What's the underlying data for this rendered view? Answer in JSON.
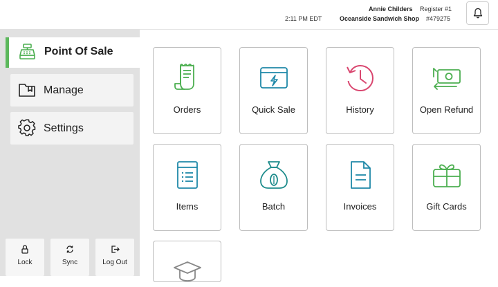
{
  "header": {
    "time": "2:11 PM EDT",
    "user_name": "Annie Childers",
    "register": "Register #1",
    "shop_name": "Oceanside Sandwich Shop",
    "shop_id": "#479275",
    "notifications_icon": "bell-icon"
  },
  "sidebar": {
    "items": [
      {
        "label": "Point Of Sale",
        "icon": "cash-register-icon",
        "active": true
      },
      {
        "label": "Manage",
        "icon": "folder-icon",
        "active": false
      },
      {
        "label": "Settings",
        "icon": "gear-icon",
        "active": false
      }
    ],
    "bottom": [
      {
        "label": "Lock",
        "icon": "lock-icon"
      },
      {
        "label": "Sync",
        "icon": "sync-icon"
      },
      {
        "label": "Log Out",
        "icon": "logout-icon"
      }
    ]
  },
  "tiles": [
    {
      "label": "Orders",
      "icon": "receipt-icon",
      "color": "#4caf50"
    },
    {
      "label": "Quick Sale",
      "icon": "card-icon",
      "color": "#1e88a8"
    },
    {
      "label": "History",
      "icon": "history-icon",
      "color": "#d9466f"
    },
    {
      "label": "Open Refund",
      "icon": "refund-icon",
      "color": "#4caf50"
    },
    {
      "label": "Items",
      "icon": "items-icon",
      "color": "#1e88a8"
    },
    {
      "label": "Batch",
      "icon": "money-bag-icon",
      "color": "#1e8c8c"
    },
    {
      "label": "Invoices",
      "icon": "invoice-icon",
      "color": "#1e88a8"
    },
    {
      "label": "Gift Cards",
      "icon": "gift-card-icon",
      "color": "#4caf50"
    },
    {
      "label": "",
      "icon": "graduation-cap-icon",
      "color": "#888888"
    }
  ],
  "colors": {
    "accent_green": "#5cb85c",
    "sidebar_bg": "#e1e1e1"
  }
}
